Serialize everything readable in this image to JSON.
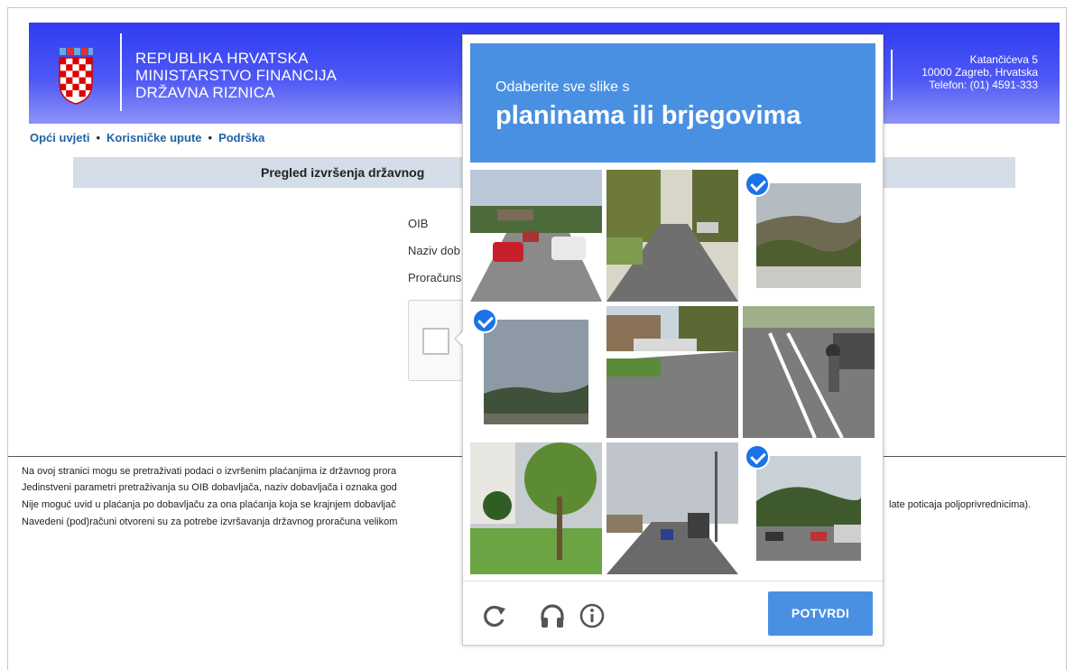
{
  "header": {
    "org_line1": "REPUBLIKA HRVATSKA",
    "org_line2": "MINISTARSTVO FINANCIJA",
    "org_line3": "DRŽAVNA RIZNICA",
    "addr_line1": "Katančićeva 5",
    "addr_line2": "10000 Zagreb, Hrvatska",
    "addr_line3": "Telefon: (01) 4591-333"
  },
  "nav": {
    "item1": "Opći uvjeti",
    "item2": "Korisničke upute",
    "item3": "Podrška",
    "separator": "•"
  },
  "page_title": "Pregled izvršenja državnog",
  "form": {
    "oib_label": "OIB",
    "naziv_label": "Naziv dob",
    "proracun_label": "Proračuns"
  },
  "info": {
    "line1": "Na ovoj stranici mogu se pretraživati podaci o izvršenim plaćanjima iz državnog prora",
    "line2": "Jedinstveni parametri pretraživanja su OIB dobavljača, naziv dobavljača i oznaka god",
    "line3": "Nije moguć uvid u plaćanja po dobavljaču za ona plaćanja koja se krajnjem dobavljač",
    "line3_tail": "late poticaja poljoprivrednicima).",
    "line4": "Navedeni (pod)računi otvoreni su za potrebe izvršavanja državnog proračuna velikom"
  },
  "captcha": {
    "instruction": "Odaberite sve slike s",
    "target": "planinama ili brjegovima",
    "verify_label": "POTVRDI",
    "tiles": [
      {
        "scene": "street-cars",
        "selected": false
      },
      {
        "scene": "residential-street",
        "selected": false
      },
      {
        "scene": "hills",
        "selected": true
      },
      {
        "scene": "mountains",
        "selected": true
      },
      {
        "scene": "parking-lot",
        "selected": false
      },
      {
        "scene": "bike-lane",
        "selected": false
      },
      {
        "scene": "building-trees",
        "selected": false
      },
      {
        "scene": "road-traffic",
        "selected": false
      },
      {
        "scene": "hill-town",
        "selected": true
      }
    ],
    "icons": [
      "reload-icon",
      "headphones-icon",
      "info-icon"
    ]
  },
  "colors": {
    "banner": "#3a44f2",
    "captcha_accent": "#4a90e2",
    "link": "#1f63a8",
    "check": "#1a73e8"
  }
}
